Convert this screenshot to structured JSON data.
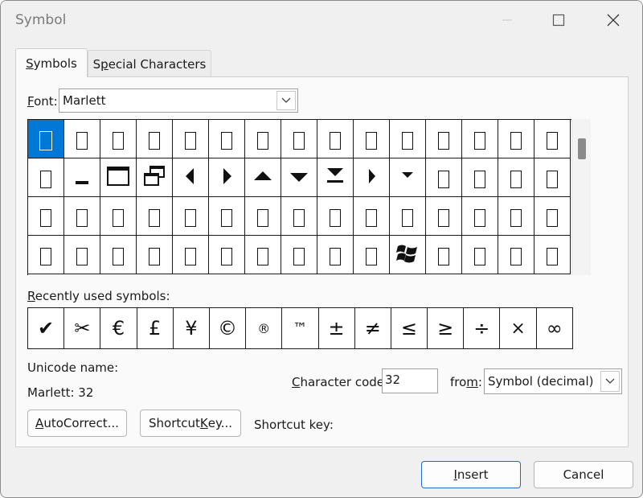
{
  "window": {
    "title": "Symbol",
    "controls": {
      "minimize": "minimize-icon",
      "maximize": "maximize-icon",
      "close": "close-icon"
    }
  },
  "tabs": [
    {
      "label": "Symbols",
      "accel": "S",
      "rest": "ymbols",
      "active": true
    },
    {
      "label": "Special Characters",
      "accel_prefix": "S",
      "accel": "p",
      "rest": "ecial Characters",
      "active": false
    }
  ],
  "font": {
    "label": "Font:",
    "accel": "F",
    "rest": "ont:",
    "value": "Marlett"
  },
  "symbol_grid": {
    "selected_index": 0,
    "cells": [
      "box",
      "box",
      "box",
      "box",
      "box",
      "box",
      "box",
      "box",
      "box",
      "box",
      "box",
      "box",
      "box",
      "box",
      "box",
      "box",
      "minimize-glyph",
      "maximize-glyph",
      "restore-glyph",
      "left-triangle",
      "right-triangle",
      "up-triangle",
      "down-triangle",
      "eject-glyph",
      "small-right-triangle",
      "small-down-triangle",
      "box",
      "box",
      "box",
      "box",
      "box",
      "box",
      "box",
      "box",
      "box",
      "box",
      "box",
      "box",
      "box",
      "box",
      "box",
      "box",
      "box",
      "box",
      "box",
      "box",
      "box",
      "box",
      "box",
      "box",
      "box",
      "box",
      "box",
      "box",
      "box",
      "windows-flag",
      "box",
      "box",
      "box",
      "box"
    ]
  },
  "recent": {
    "label_accel": "R",
    "label_rest": "ecently used symbols:",
    "symbols": [
      "✔",
      "✂",
      "€",
      "£",
      "¥",
      "©",
      "®",
      "™",
      "±",
      "≠",
      "≤",
      "≥",
      "÷",
      "×",
      "∞"
    ]
  },
  "unicode_name": {
    "label": "Unicode name:",
    "value": "Marlett: 32"
  },
  "character_code": {
    "label_accel": "C",
    "label_rest": "haracter code:",
    "value": "32"
  },
  "from": {
    "label_pre": "fro",
    "label_accel": "m",
    "label_post": ":",
    "value": "Symbol (decimal)"
  },
  "buttons": {
    "autocorrect": {
      "accel": "A",
      "rest": "utoCorrect..."
    },
    "shortcut_key": {
      "pre": "Shortcut ",
      "accel": "K",
      "rest": "ey..."
    },
    "insert": {
      "accel": "I",
      "rest": "nsert"
    },
    "cancel": "Cancel"
  },
  "shortcut_key_label": "Shortcut key:",
  "colors": {
    "selection": "#0078d7",
    "default_button_border": "#1f69c8"
  }
}
